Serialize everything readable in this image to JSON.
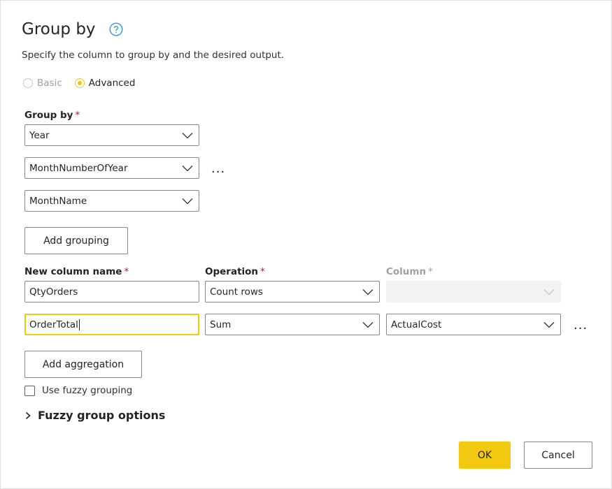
{
  "dialog": {
    "title": "Group by",
    "subtitle": "Specify the column to group by and the desired output."
  },
  "mode": {
    "options": [
      {
        "label": "Basic",
        "selected": false,
        "disabled": true
      },
      {
        "label": "Advanced",
        "selected": true,
        "disabled": false
      }
    ]
  },
  "group_by": {
    "label": "Group by",
    "required_mark": "*",
    "columns": [
      "Year",
      "MonthNumberOfYear",
      "MonthName"
    ],
    "more_label": "...",
    "add_button": "Add grouping"
  },
  "aggregations": {
    "headers": {
      "new_column_name": "New column name",
      "operation": "Operation",
      "column": "Column",
      "required_mark": "*"
    },
    "rows": [
      {
        "name": "QtyOrders",
        "operation": "Count rows",
        "column": ""
      },
      {
        "name": "OrderTotal",
        "operation": "Sum",
        "column": "ActualCost"
      }
    ],
    "more_label": "...",
    "add_button": "Add aggregation"
  },
  "fuzzy": {
    "checkbox_label": "Use fuzzy grouping",
    "options_label": "Fuzzy group options"
  },
  "footer": {
    "ok": "OK",
    "cancel": "Cancel"
  },
  "colors": {
    "accent": "#f2c811",
    "help_icon": "#3a96dd",
    "required": "#a4262c"
  }
}
